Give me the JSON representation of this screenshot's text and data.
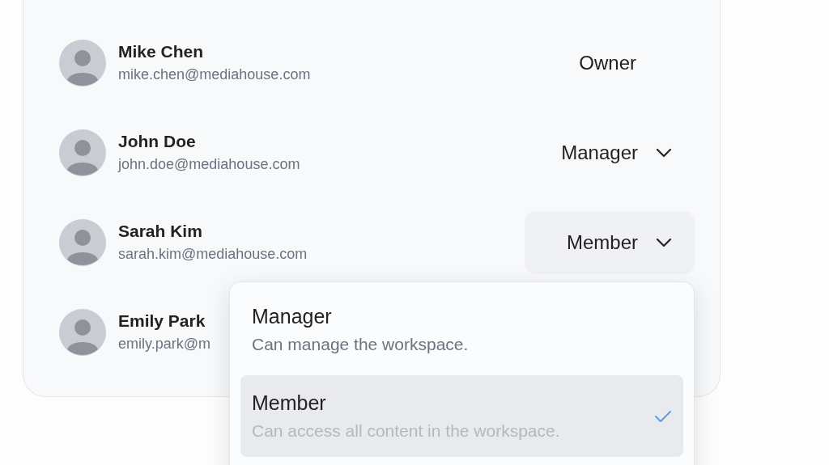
{
  "members": [
    {
      "name": "Mike Chen",
      "email": "mike.chen@mediahouse.com",
      "role": {
        "label": "Owner",
        "kind": "static"
      }
    },
    {
      "name": "John Doe",
      "email": "john.doe@mediahouse.com",
      "role": {
        "label": "Manager",
        "kind": "dropdown"
      }
    },
    {
      "name": "Sarah Kim",
      "email": "sarah.kim@mediahouse.com",
      "role": {
        "label": "Member",
        "kind": "open-dropdown"
      }
    },
    {
      "name": "Emily Park",
      "email": "emily.park@m"
    }
  ],
  "role_menu": {
    "options": [
      {
        "title": "Manager",
        "description": "Can manage the workspace.",
        "selected": false
      },
      {
        "title": "Member",
        "description": "Can access all content in the workspace.",
        "selected": true
      }
    ]
  }
}
